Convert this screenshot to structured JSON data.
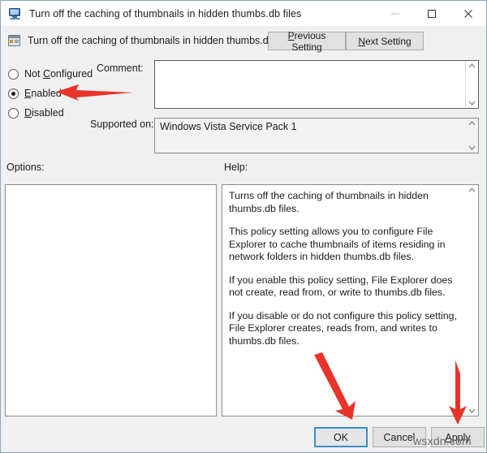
{
  "window": {
    "title": "Turn off the caching of thumbnails in hidden thumbs.db files",
    "title_icon": "monitor-policy-icon",
    "controls": {
      "minimize": "minimize-icon",
      "maximize": "maximize-icon",
      "close": "close-icon"
    }
  },
  "header": {
    "icon": "policy-setting-icon",
    "setting_name": "Turn off the caching of thumbnails in hidden thumbs.db files",
    "previous_button": "Previous Setting",
    "previous_accel": "P",
    "next_button": "Next Setting",
    "next_accel": "N"
  },
  "state": {
    "options": [
      {
        "id": "not-configured",
        "label": "Not Configured",
        "accel": "C",
        "selected": false
      },
      {
        "id": "enabled",
        "label": "Enabled",
        "accel": "E",
        "selected": true
      },
      {
        "id": "disabled",
        "label": "Disabled",
        "accel": "D",
        "selected": false
      }
    ]
  },
  "comment": {
    "label": "Comment:",
    "value": "",
    "scroll_up_icon": "chevron-up-icon",
    "scroll_down_icon": "chevron-down-icon"
  },
  "supported": {
    "label": "Supported on:",
    "value": "Windows Vista Service Pack 1",
    "scroll_up_icon": "chevron-up-icon",
    "scroll_down_icon": "chevron-down-icon"
  },
  "options_panel": {
    "label": "Options:",
    "content": ""
  },
  "help_panel": {
    "label": "Help:",
    "paragraphs": [
      "Turns off the caching of thumbnails in hidden thumbs.db files.",
      "This policy setting allows you to configure File Explorer to cache thumbnails of items residing in network folders in hidden thumbs.db files.",
      "If you enable this policy setting, File Explorer does not create, read from, or write to thumbs.db files.",
      "If you disable or do not configure this policy setting, File Explorer creates, reads from, and writes to thumbs.db files."
    ],
    "scroll_up_icon": "chevron-up-icon",
    "scroll_down_icon": "chevron-down-icon"
  },
  "footer": {
    "ok": "OK",
    "cancel": "Cancel",
    "apply": "Apply",
    "apply_accel": "A",
    "focused_button": "OK"
  },
  "annotations": {
    "arrow_color": "#e8332a",
    "arrows": [
      {
        "name": "arrow-pointing-enabled",
        "target": "enabled-radio",
        "direction": "left"
      },
      {
        "name": "arrow-pointing-ok",
        "target": "ok-button",
        "direction": "down-right"
      },
      {
        "name": "arrow-pointing-apply",
        "target": "apply-button",
        "direction": "down"
      }
    ],
    "watermark": "wsxdn.com"
  }
}
